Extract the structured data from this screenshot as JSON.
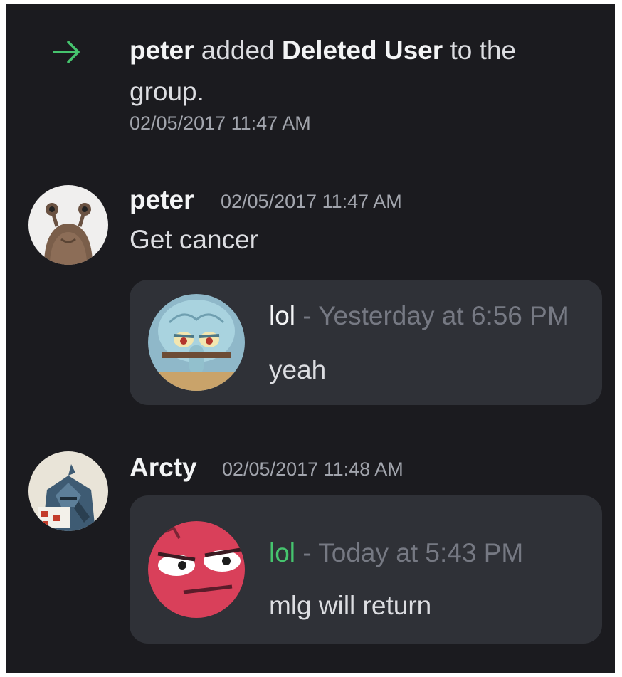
{
  "system_message": {
    "actor": "peter",
    "verb": "added",
    "target": "Deleted User",
    "suffix": "to the group.",
    "timestamp": "02/05/2017 11:47 AM",
    "icon": "arrow-right-icon",
    "icon_color": "#46c46e"
  },
  "messages": [
    {
      "author": "peter",
      "timestamp": "02/05/2017 11:47 AM",
      "text": "Get cancer",
      "avatar": "snail-avatar",
      "quote": {
        "author": "lol",
        "separator": "-",
        "timestamp": "Yesterday at 6:56 PM",
        "text": "yeah",
        "avatar": "squidward-avatar"
      }
    },
    {
      "author": "Arcty",
      "timestamp": "02/05/2017 11:48 AM",
      "avatar": "knight-avatar",
      "quote": {
        "author": "lol",
        "author_color": "#46c46e",
        "separator": "-",
        "timestamp": "Today at 5:43 PM",
        "text": "mlg will return",
        "avatar": "red-face-avatar"
      }
    }
  ],
  "colors": {
    "background": "#1b1b1f",
    "embed_background": "#2f3137",
    "primary_text": "#f3f4f5",
    "muted_text": "#a2a5ad"
  }
}
